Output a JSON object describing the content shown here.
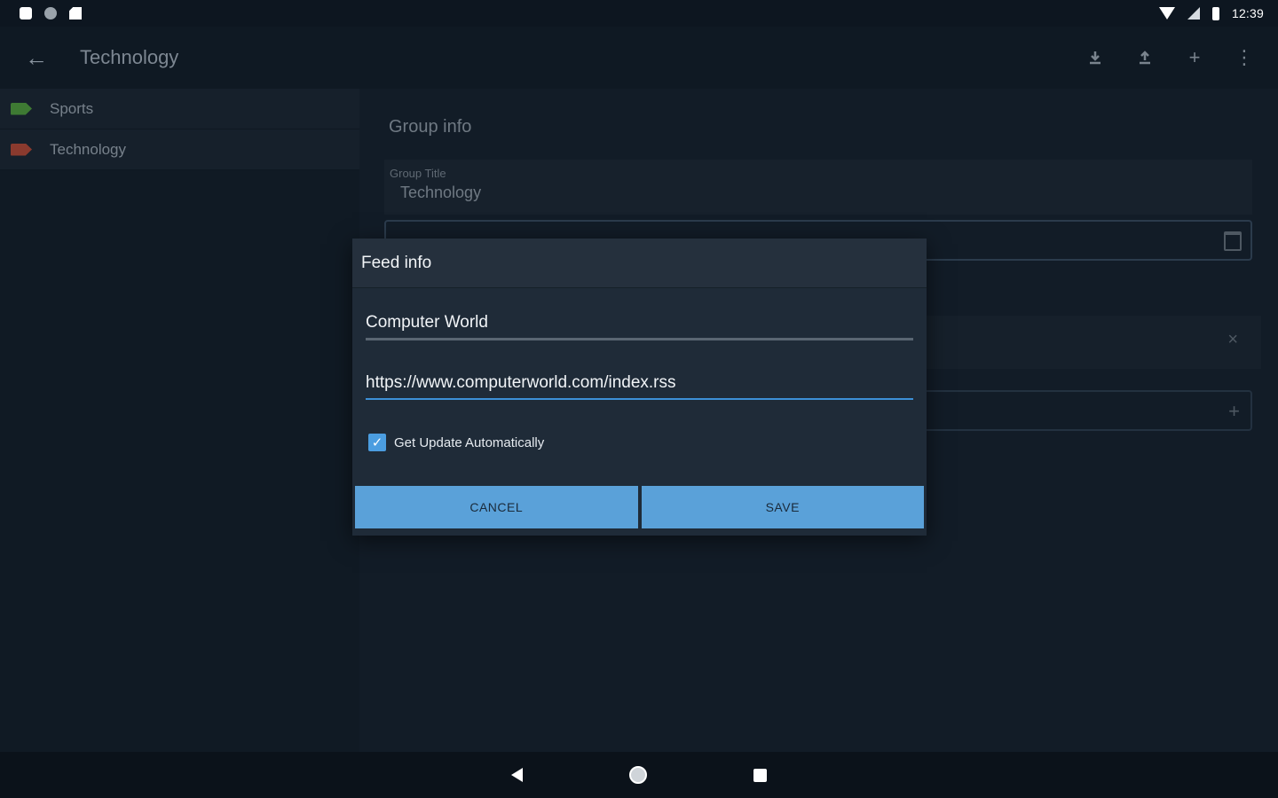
{
  "status_bar": {
    "time": "12:39",
    "left_icons": [
      "notification-icon",
      "circle-icon",
      "sd-card-icon"
    ],
    "right_icons": [
      "wifi-icon",
      "signal-icon",
      "battery-icon"
    ]
  },
  "toolbar": {
    "back_icon": "arrow-back-icon",
    "title": "Technology",
    "actions": [
      "download-icon",
      "upload-icon",
      "add-icon",
      "more-vert-icon"
    ]
  },
  "sidebar": {
    "items": [
      {
        "label": "Sports",
        "tag_color": "#3e7a33"
      },
      {
        "label": "Technology",
        "tag_color": "#8a3a2e"
      }
    ]
  },
  "main": {
    "heading": "Group info",
    "group_title_label": "Group Title",
    "group_title_value": "Technology"
  },
  "dialog": {
    "title": "Feed info",
    "name_value": "Computer World",
    "url_value": "https://www.computerworld.com/index.rss",
    "checkbox_label": "Get Update Automatically",
    "checkbox_checked": true,
    "cancel_label": "CANCEL",
    "save_label": "SAVE"
  },
  "colors": {
    "accent": "#5aa1d9",
    "focus_line": "#3c8fd6",
    "background": "#121c27"
  }
}
